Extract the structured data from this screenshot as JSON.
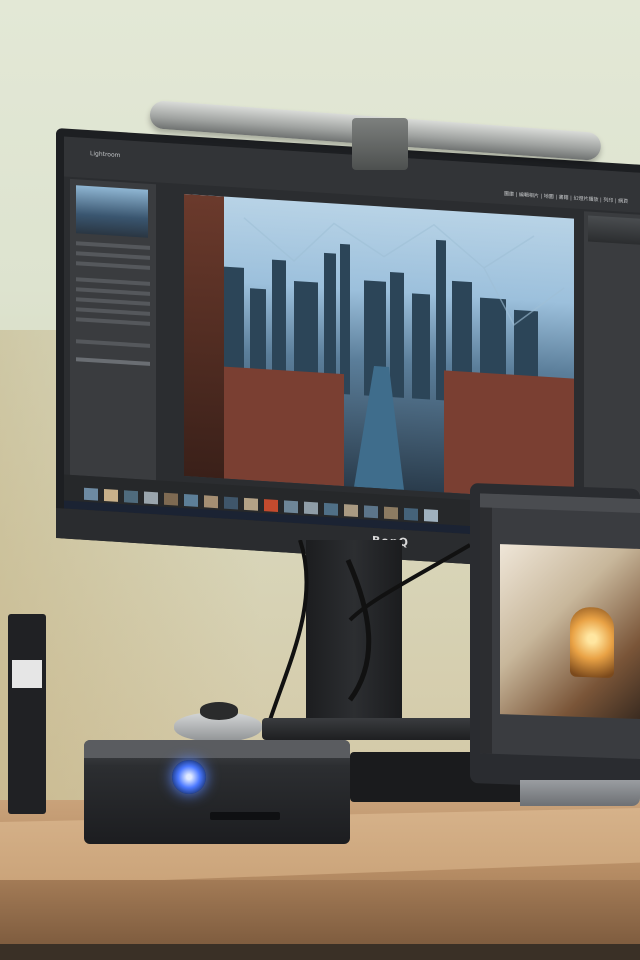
{
  "scene": {
    "description_free": true,
    "monitor": {
      "brand_logo": "BenQ",
      "app_title": "Lightroom",
      "menu_text": "圖庫 | 編輯相片 | 地圖 | 書籍 | 幻燈片播放 | 列印 | 網頁"
    },
    "colors": {
      "wall": "#dfe4d2",
      "desk": "#b98f66",
      "monitor_body": "#1d1f22",
      "drive_led": "#4a78ff",
      "lamp_metal": "#9ea19f"
    },
    "icons": [
      "benq-logo",
      "drive-led-indicator"
    ]
  }
}
